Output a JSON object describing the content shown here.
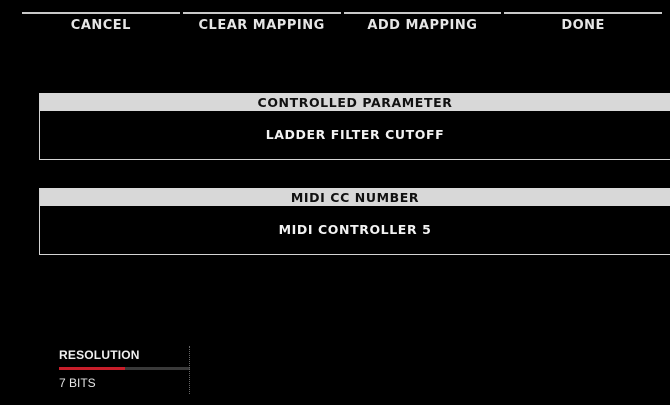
{
  "toolbar": {
    "cancel": "CANCEL",
    "clear_mapping": "CLEAR MAPPING",
    "add_mapping": "ADD MAPPING",
    "done": "DONE"
  },
  "controlled_parameter": {
    "header": "CONTROLLED PARAMETER",
    "value": "LADDER FILTER CUTOFF"
  },
  "midi_cc": {
    "header": "MIDI CC NUMBER",
    "value": "MIDI CONTROLLER 5"
  },
  "resolution": {
    "label": "RESOLUTION",
    "value": "7 BITS",
    "level_fraction": 0.5
  },
  "colors": {
    "background": "#000000",
    "header_bg": "#d8d8d8",
    "accent": "#c81e2a"
  }
}
